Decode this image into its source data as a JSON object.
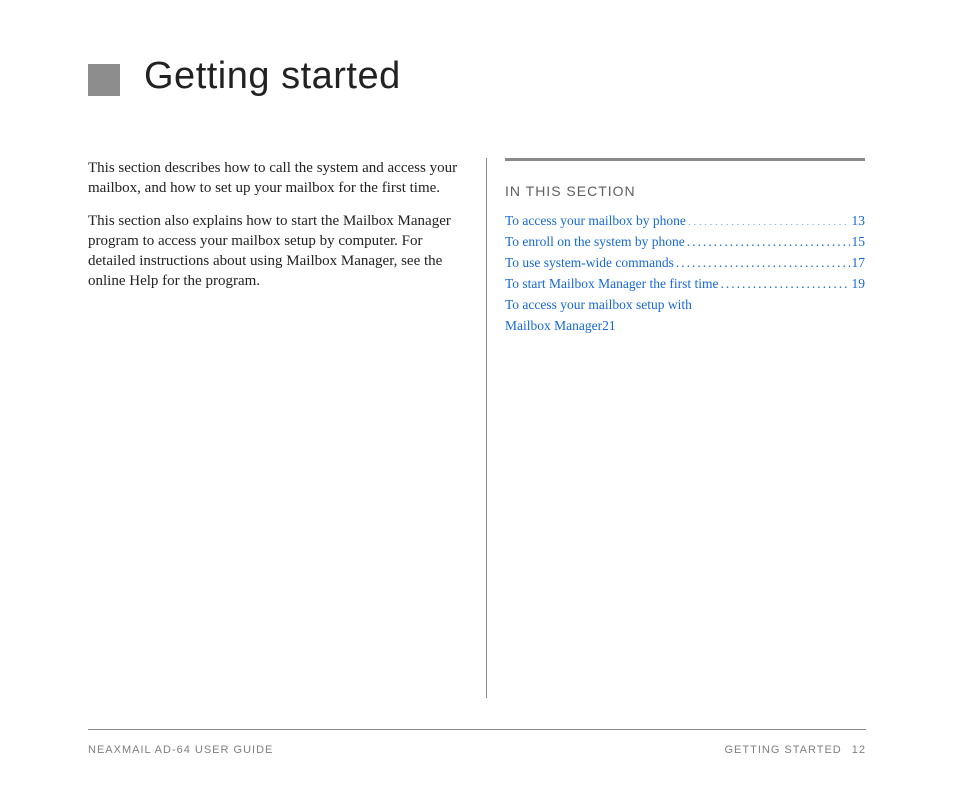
{
  "heading": "Getting started",
  "intro": {
    "p1": "This section describes how to call the system and access your mailbox, and how to set up your mailbox for the first time.",
    "p2": "This section also explains how to start the Mailbox Manager program to access your mailbox setup by computer. For detailed instructions about using Mailbox Manager, see the online Help for the program."
  },
  "section_label": "IN THIS SECTION",
  "toc": [
    {
      "label": "To access your mailbox by phone",
      "page": "13"
    },
    {
      "label": "To enroll on the system by phone",
      "page": "15"
    },
    {
      "label": "To use system-wide commands",
      "page": "17"
    },
    {
      "label": "To start Mailbox Manager the first time",
      "page": "19"
    },
    {
      "label_line1": "To access your mailbox setup with",
      "label_line2": "Mailbox Manager",
      "page": "21",
      "multiline": true
    }
  ],
  "footer": {
    "left": "NEAXMAIL AD-64 USER GUIDE",
    "right_label": "GETTING STARTED",
    "page_number": "12"
  }
}
